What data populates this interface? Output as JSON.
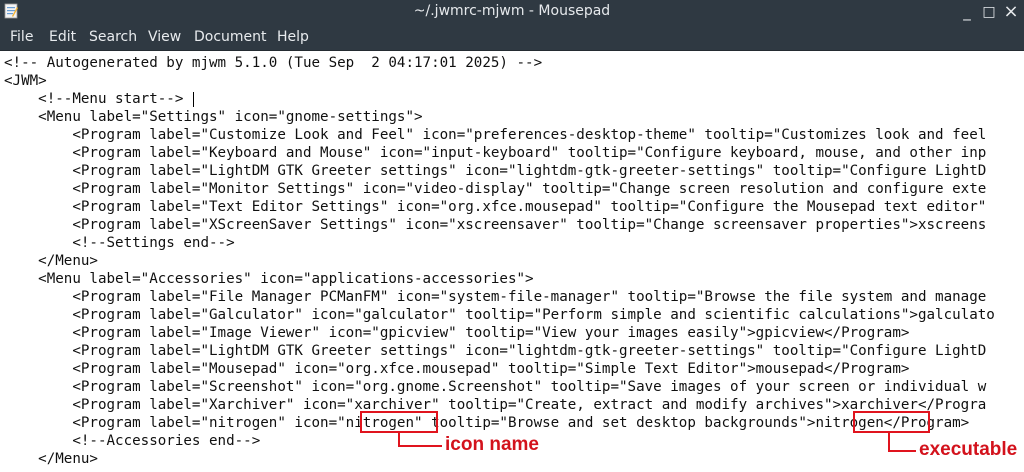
{
  "window": {
    "title": "~/.jwmrc-mjwm - Mousepad",
    "controls": {
      "minimize": "_",
      "maximize": "□",
      "close": "×"
    }
  },
  "menubar": [
    "File",
    "Edit",
    "Search",
    "View",
    "Document",
    "Help"
  ],
  "lines": [
    "<!-- Autogenerated by mjwm 5.1.0 (Tue Sep  2 04:17:01 2025) -->",
    "<JWM>",
    "    <!--Menu start-->",
    "    <Menu label=\"Settings\" icon=\"gnome-settings\">",
    "        <Program label=\"Customize Look and Feel\" icon=\"preferences-desktop-theme\" tooltip=\"Customizes look and feel",
    "        <Program label=\"Keyboard and Mouse\" icon=\"input-keyboard\" tooltip=\"Configure keyboard, mouse, and other inp",
    "        <Program label=\"LightDM GTK Greeter settings\" icon=\"lightdm-gtk-greeter-settings\" tooltip=\"Configure LightD",
    "        <Program label=\"Monitor Settings\" icon=\"video-display\" tooltip=\"Change screen resolution and configure exte",
    "        <Program label=\"Text Editor Settings\" icon=\"org.xfce.mousepad\" tooltip=\"Configure the Mousepad text editor\"",
    "        <Program label=\"XScreenSaver Settings\" icon=\"xscreensaver\" tooltip=\"Change screensaver properties\">xscreens",
    "        <!--Settings end-->",
    "    </Menu>",
    "    <Menu label=\"Accessories\" icon=\"applications-accessories\">",
    "        <Program label=\"File Manager PCManFM\" icon=\"system-file-manager\" tooltip=\"Browse the file system and manage",
    "        <Program label=\"Galculator\" icon=\"galculator\" tooltip=\"Perform simple and scientific calculations\">galculato",
    "        <Program label=\"Image Viewer\" icon=\"gpicview\" tooltip=\"View your images easily\">gpicview</Program>",
    "        <Program label=\"LightDM GTK Greeter settings\" icon=\"lightdm-gtk-greeter-settings\" tooltip=\"Configure LightD",
    "        <Program label=\"Mousepad\" icon=\"org.xfce.mousepad\" tooltip=\"Simple Text Editor\">mousepad</Program>",
    "        <Program label=\"Screenshot\" icon=\"org.gnome.Screenshot\" tooltip=\"Save images of your screen or individual w",
    "        <Program label=\"Xarchiver\" icon=\"xarchiver\" tooltip=\"Create, extract and modify archives\">xarchiver</Progra",
    "        <Program label=\"nitrogen\" icon=\"nitrogen\" tooltip=\"Browse and set desktop backgrounds\">nitrogen</Program>",
    "        <!--Accessories end-->",
    "    </Menu>"
  ],
  "annotations": {
    "icon_label": "icon name",
    "exec_label": "executable",
    "color": "#e0141e"
  }
}
